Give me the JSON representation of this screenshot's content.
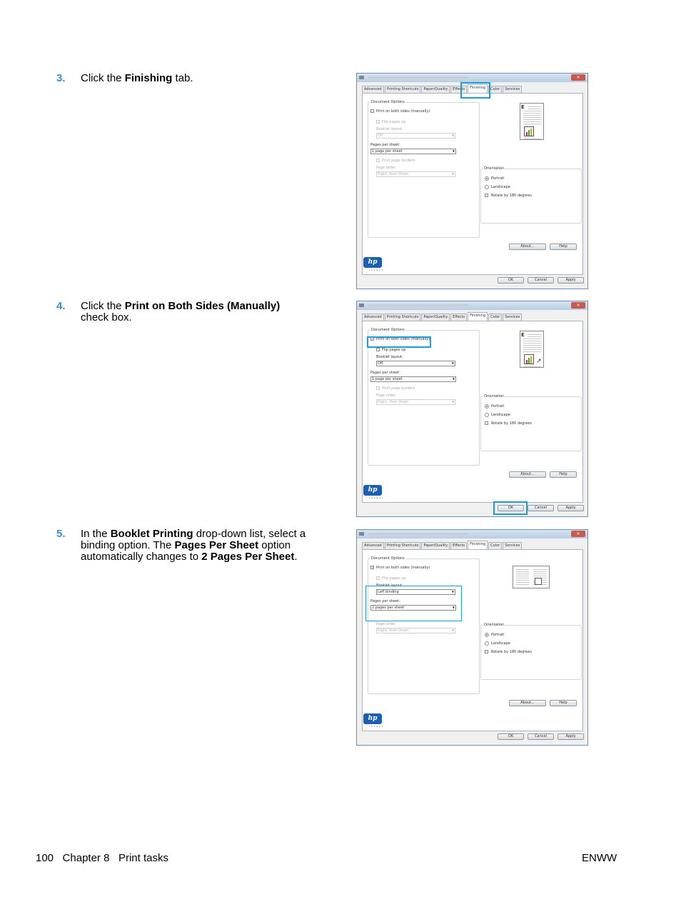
{
  "steps": [
    {
      "number": "3.",
      "parts": [
        "Click the ",
        "Finishing",
        " tab."
      ]
    },
    {
      "number": "4.",
      "parts": [
        "Click the ",
        "Print on Both Sides (Manually)",
        " check box."
      ]
    },
    {
      "number": "5.",
      "parts": [
        "In the ",
        "Booklet Printing",
        " drop-down list, select a binding option. The ",
        "Pages Per Sheet",
        " option automatically changes to ",
        "2 Pages Per Sheet",
        "."
      ]
    }
  ],
  "dialog": {
    "tabs": [
      "Advanced",
      "Printing Shortcuts",
      "Paper/Quality",
      "Effects",
      "Finishing",
      "Color",
      "Services"
    ],
    "document_options": "Document Options",
    "print_both_sides": "Print on both sides (manually)",
    "flip_pages_up": "Flip pages up",
    "booklet_layout": "Booklet layout:",
    "pages_per_sheet": "Pages per sheet:",
    "print_page_borders": "Print page borders",
    "page_order": "Page order:",
    "page_order_value": "Right, then Down",
    "orientation": "Orientation",
    "portrait": "Portrait",
    "landscape": "Landscape",
    "rotate": "Rotate by 180 degrees",
    "about": "About...",
    "help": "Help",
    "ok": "OK",
    "cancel": "Cancel",
    "apply": "Apply",
    "hp_logo": "hp",
    "hp_invent": "invent",
    "shots": [
      {
        "booklet_value": "Off",
        "pps_value": "1 page per sheet",
        "duplex_checked": false
      },
      {
        "booklet_value": "Off",
        "pps_value": "1 page per sheet",
        "duplex_checked": true
      },
      {
        "booklet_value": "Left binding",
        "pps_value": "2 pages per sheet",
        "duplex_checked": true
      }
    ]
  },
  "footer": {
    "page_number": "100",
    "chapter": "Chapter 8",
    "section": "Print tasks",
    "right": "ENWW"
  },
  "colors": {
    "step_number": "#3a8fd0",
    "highlight": "#1c9bd6"
  }
}
